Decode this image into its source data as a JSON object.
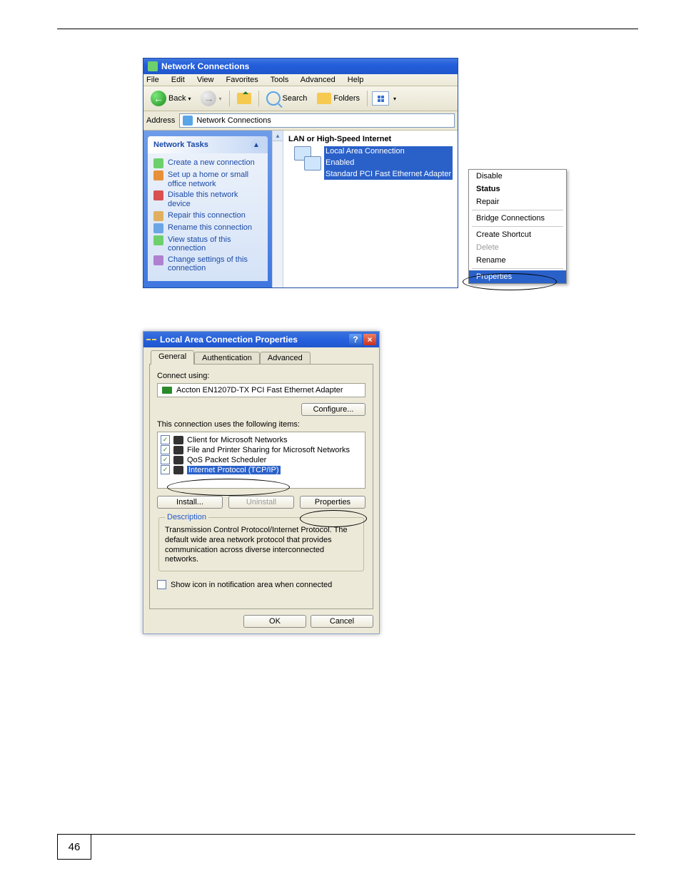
{
  "page_number": "46",
  "fig1": {
    "title": "Network Connections",
    "menubar": [
      "File",
      "Edit",
      "View",
      "Favorites",
      "Tools",
      "Advanced",
      "Help"
    ],
    "toolbar": {
      "back": "Back",
      "search": "Search",
      "folders": "Folders"
    },
    "address_label": "Address",
    "address_value": "Network Connections",
    "sidebar": {
      "heading": "Network Tasks",
      "items": [
        "Create a new connection",
        "Set up a home or small office network",
        "Disable this network device",
        "Repair this connection",
        "Rename this connection",
        "View status of this connection",
        "Change settings of this connection"
      ]
    },
    "section_head": "LAN or High-Speed Internet",
    "connection": {
      "name": "Local Area Connection",
      "status": "Enabled",
      "adapter": "Standard PCI Fast Ethernet Adapter"
    },
    "context_menu": {
      "items": [
        "Disable",
        "Status",
        "Repair",
        "Bridge Connections",
        "Create Shortcut",
        "Delete",
        "Rename",
        "Properties"
      ],
      "bold": "Status",
      "disabled": "Delete",
      "selected": "Properties"
    }
  },
  "fig2": {
    "title": "Local Area Connection Properties",
    "tabs": [
      "General",
      "Authentication",
      "Advanced"
    ],
    "connect_using_label": "Connect using:",
    "adapter": "Accton EN1207D-TX PCI Fast Ethernet Adapter",
    "configure_btn": "Configure...",
    "uses_label": "This connection uses the following items:",
    "items": [
      "Client for Microsoft Networks",
      "File and Printer Sharing for Microsoft Networks",
      "QoS Packet Scheduler",
      "Internet Protocol (TCP/IP)"
    ],
    "install_btn": "Install...",
    "uninstall_btn": "Uninstall",
    "properties_btn": "Properties",
    "desc_heading": "Description",
    "desc_text": "Transmission Control Protocol/Internet Protocol. The default wide area network protocol that provides communication across diverse interconnected networks.",
    "show_icon_label": "Show icon in notification area when connected",
    "ok": "OK",
    "cancel": "Cancel"
  }
}
